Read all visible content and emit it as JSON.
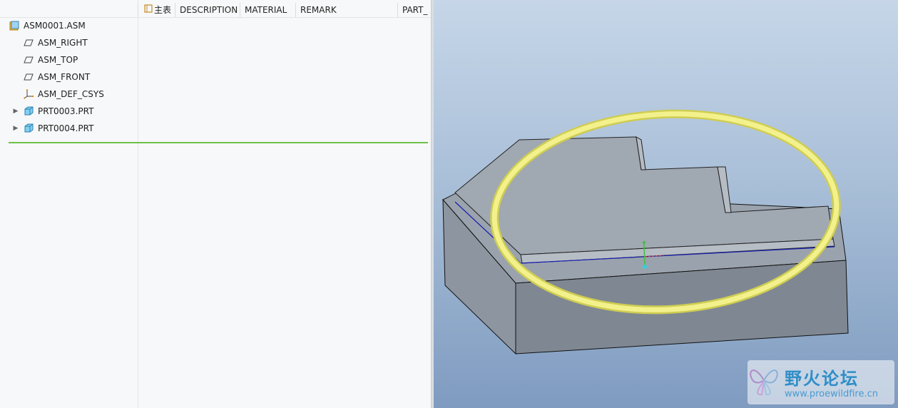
{
  "model_tree": {
    "columns": [
      {
        "label": "主表",
        "icon": "tree-column-icon"
      },
      {
        "label": "DESCRIPTION"
      },
      {
        "label": "MATERIAL"
      },
      {
        "label": "REMARK"
      },
      {
        "label": "PART_"
      }
    ],
    "items": [
      {
        "label": "ASM0001.ASM",
        "icon": "assembly-icon",
        "expandable": false
      },
      {
        "label": "ASM_RIGHT",
        "icon": "datum-plane-icon",
        "expandable": false
      },
      {
        "label": "ASM_TOP",
        "icon": "datum-plane-icon",
        "expandable": false
      },
      {
        "label": "ASM_FRONT",
        "icon": "datum-plane-icon",
        "expandable": false
      },
      {
        "label": "ASM_DEF_CSYS",
        "icon": "coordinate-system-icon",
        "expandable": false
      },
      {
        "label": "PRT0003.PRT",
        "icon": "part-icon",
        "expandable": true
      },
      {
        "label": "PRT0004.PRT",
        "icon": "part-icon",
        "expandable": true
      }
    ],
    "insert_marker_color": "#6cc04a"
  },
  "viewport": {
    "background_top": "#c6d6e8",
    "background_bottom": "#7f9bc0",
    "highlight_ring_color": "#f0ee7a"
  },
  "watermark": {
    "title": "野火论坛",
    "url": "www.proewildfire.cn"
  }
}
